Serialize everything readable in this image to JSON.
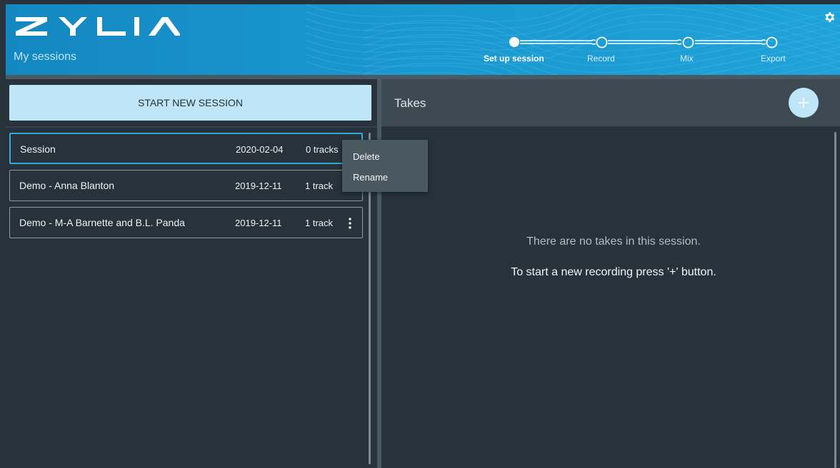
{
  "header": {
    "logo_text": "ZYLIA",
    "page_title": "My sessions",
    "settings_icon": "gear-icon",
    "colors": {
      "header_blue": "#1a97cf",
      "accent": "#36a9dc"
    },
    "steps": [
      {
        "label": "Set up session",
        "active": true
      },
      {
        "label": "Record",
        "active": false
      },
      {
        "label": "Mix",
        "active": false
      },
      {
        "label": "Export",
        "active": false
      }
    ]
  },
  "sessions": {
    "start_button_label": "START NEW SESSION",
    "items": [
      {
        "name": "Session",
        "date": "2020-02-04",
        "tracks": "0 tracks",
        "selected": true
      },
      {
        "name": "Demo - Anna Blanton",
        "date": "2019-12-11",
        "tracks": "1 track",
        "selected": false
      },
      {
        "name": "Demo - M-A Barnette and B.L. Panda",
        "date": "2019-12-11",
        "tracks": "1 track",
        "selected": false
      }
    ]
  },
  "context_menu": {
    "items": [
      {
        "label": "Delete"
      },
      {
        "label": "Rename"
      }
    ]
  },
  "takes": {
    "title": "Takes",
    "add_icon": "plus-icon",
    "empty_message": "There are no takes in this session.",
    "empty_hint": "To start a new recording press '+' button."
  }
}
